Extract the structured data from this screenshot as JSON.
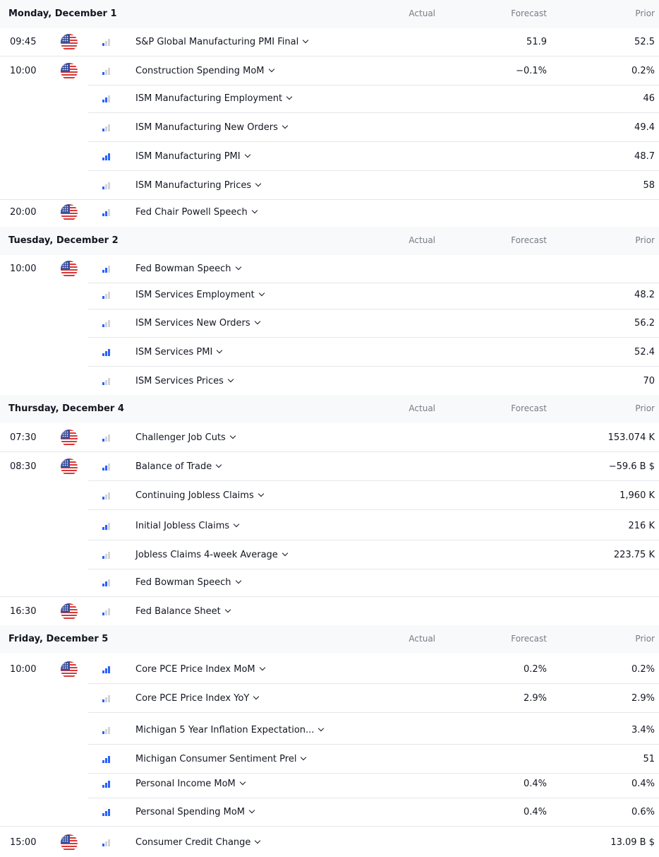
{
  "columns": {
    "actual": "Actual",
    "forecast": "Forecast",
    "prior": "Prior"
  },
  "days": [
    {
      "title": "Monday, December 1",
      "events": [
        {
          "time": "09:45",
          "flag": "us-flag-icon",
          "importance": 1,
          "name": "S&P Global Manufacturing PMI Final",
          "forecast": "51.9",
          "prior": "52.5"
        },
        {
          "time": "10:00",
          "flag": "us-flag-icon",
          "importance": 1,
          "name": "Construction Spending MoM",
          "forecast": "−0.1%",
          "prior": "0.2%"
        },
        {
          "time": "",
          "importance": 2,
          "name": "ISM Manufacturing Employment",
          "forecast": "",
          "prior": "46"
        },
        {
          "time": "",
          "importance": 1,
          "name": "ISM Manufacturing New Orders",
          "forecast": "",
          "prior": "49.4"
        },
        {
          "time": "",
          "importance": 3,
          "name": "ISM Manufacturing PMI",
          "forecast": "",
          "prior": "48.7"
        },
        {
          "time": "",
          "importance": 1,
          "name": "ISM Manufacturing Prices",
          "forecast": "",
          "prior": "58"
        },
        {
          "time": "20:00",
          "flag": "us-flag-icon",
          "importance": 2,
          "name": "Fed Chair Powell Speech",
          "forecast": "",
          "prior": ""
        }
      ]
    },
    {
      "title": "Tuesday, December 2",
      "events": [
        {
          "time": "10:00",
          "flag": "us-flag-icon",
          "importance": 2,
          "name": "Fed Bowman Speech",
          "forecast": "",
          "prior": ""
        },
        {
          "time": "",
          "importance": 1,
          "name": "ISM Services Employment",
          "forecast": "",
          "prior": "48.2"
        },
        {
          "time": "",
          "importance": 1,
          "name": "ISM Services New Orders",
          "forecast": "",
          "prior": "56.2"
        },
        {
          "time": "",
          "importance": 3,
          "name": "ISM Services PMI",
          "forecast": "",
          "prior": "52.4"
        },
        {
          "time": "",
          "importance": 1,
          "name": "ISM Services Prices",
          "forecast": "",
          "prior": "70"
        }
      ]
    },
    {
      "title": "Thursday, December 4",
      "events": [
        {
          "time": "07:30",
          "flag": "us-flag-icon",
          "importance": 1,
          "name": "Challenger Job Cuts",
          "forecast": "",
          "prior": "153.074 K"
        },
        {
          "time": "08:30",
          "flag": "us-flag-icon",
          "importance": 2,
          "name": "Balance of Trade",
          "forecast": "",
          "prior": "−59.6 B $"
        },
        {
          "time": "",
          "importance": 1,
          "name": "Continuing Jobless Claims",
          "forecast": "",
          "prior": "1,960 K"
        },
        {
          "time": "",
          "importance": 2,
          "name": "Initial Jobless Claims",
          "forecast": "",
          "prior": "216 K"
        },
        {
          "time": "",
          "importance": 1,
          "name": "Jobless Claims 4-week Average",
          "forecast": "",
          "prior": "223.75 K"
        },
        {
          "time": "",
          "importance": 2,
          "name": "Fed Bowman Speech",
          "forecast": "",
          "prior": ""
        },
        {
          "time": "16:30",
          "flag": "us-flag-icon",
          "importance": 1,
          "name": "Fed Balance Sheet",
          "forecast": "",
          "prior": ""
        }
      ]
    },
    {
      "title": "Friday, December 5",
      "events": [
        {
          "time": "10:00",
          "flag": "us-flag-icon",
          "importance": 3,
          "name": "Core PCE Price Index MoM",
          "forecast": "0.2%",
          "prior": "0.2%"
        },
        {
          "time": "",
          "importance": 1,
          "name": "Core PCE Price Index YoY",
          "forecast": "2.9%",
          "prior": "2.9%"
        },
        {
          "time": "",
          "importance": 1,
          "name": "Michigan 5 Year Inflation Expectation...",
          "forecast": "",
          "prior": "3.4%"
        },
        {
          "time": "",
          "importance": 3,
          "name": "Michigan Consumer Sentiment Prel",
          "forecast": "",
          "prior": "51"
        },
        {
          "time": "",
          "importance": 3,
          "name": "Personal Income MoM",
          "forecast": "0.4%",
          "prior": "0.4%"
        },
        {
          "time": "",
          "importance": 3,
          "name": "Personal Spending MoM",
          "forecast": "0.4%",
          "prior": "0.6%"
        },
        {
          "time": "15:00",
          "flag": "us-flag-icon",
          "importance": 1,
          "name": "Consumer Credit Change",
          "forecast": "",
          "prior": "13.09 B $"
        }
      ]
    }
  ]
}
